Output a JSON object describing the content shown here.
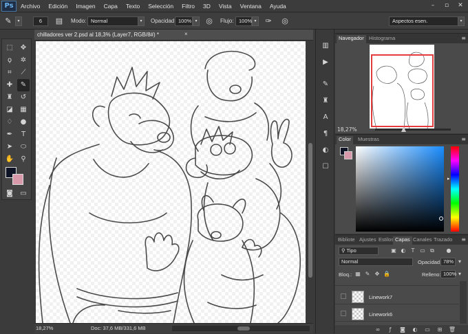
{
  "menubar": {
    "logo": "Ps",
    "items": [
      "Archivo",
      "Edición",
      "Imagen",
      "Capa",
      "Texto",
      "Selección",
      "Filtro",
      "3D",
      "Vista",
      "Ventana",
      "Ayuda"
    ],
    "window_controls": [
      "–",
      "▫",
      "✕"
    ]
  },
  "options": {
    "brush_size": "6",
    "mode_label": "Modo:",
    "mode_value": "Normal",
    "opacity_label": "Opacidad:",
    "opacity_value": "100%",
    "flow_label": "Flujo:",
    "flow_value": "100%",
    "workspace": "Aspectos esen."
  },
  "document": {
    "tab_title": "chilladores ver 2.psd al 18,3% (Layer7, RGB/8#) *",
    "close": "×",
    "zoom": "18,27%",
    "info": "Doc: 37,6 MB/331,6 MB"
  },
  "navigator": {
    "tabs": [
      "Navegador",
      "Histograma"
    ],
    "zoom": "18,27%"
  },
  "color": {
    "tabs": [
      "Color",
      "Muestras"
    ],
    "foreground": "#0e1326",
    "background": "#d89aaa"
  },
  "layers": {
    "tabs": [
      "Bibliote",
      "Ajustes",
      "Estilos",
      "Capas",
      "Canales",
      "Trazado"
    ],
    "filter": "Tipo",
    "blend_mode": "Normal",
    "opacity_label": "Opacidad:",
    "opacity_value": "78%",
    "lock_label": "Bloq.:",
    "fill_label": "Relleno:",
    "fill_value": "100%",
    "rows": [
      {
        "name": "Linework7"
      },
      {
        "name": "Linework6"
      }
    ]
  }
}
